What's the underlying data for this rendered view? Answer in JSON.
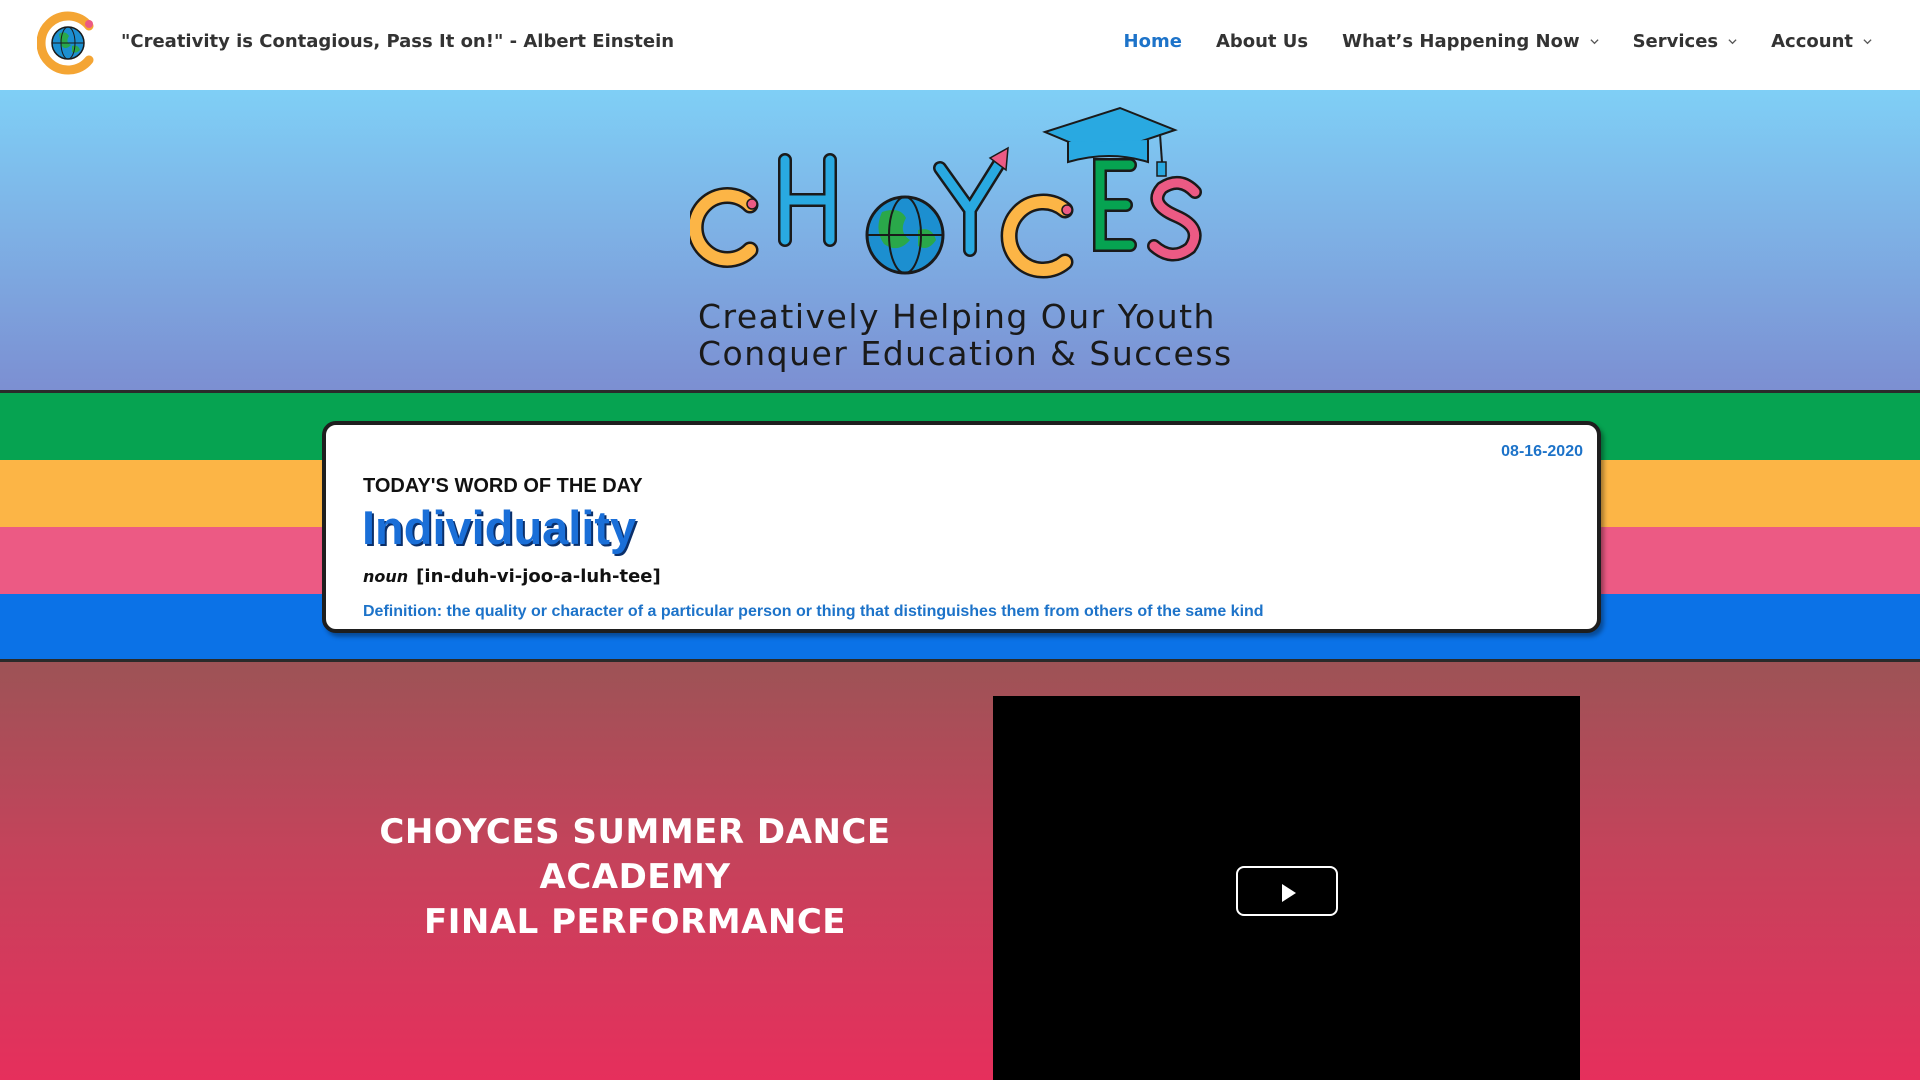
{
  "header": {
    "tagline": "\"Creativity is Contagious, Pass It on!\" - Albert Einstein",
    "nav": [
      {
        "label": "Home",
        "active": true,
        "dropdown": false
      },
      {
        "label": "About Us",
        "active": false,
        "dropdown": false
      },
      {
        "label": "What’s Happening Now",
        "active": false,
        "dropdown": true
      },
      {
        "label": "Services",
        "active": false,
        "dropdown": true
      },
      {
        "label": "Account",
        "active": false,
        "dropdown": true
      }
    ]
  },
  "hero": {
    "logo_text": "CHOYCES",
    "subtitle_line1": "Creatively Helping Our Youth",
    "subtitle_line2": "Conquer Education & Success"
  },
  "word_of_day": {
    "date": "08-16-2020",
    "label": "TODAY'S WORD OF THE DAY",
    "word": "Individuality",
    "part_of_speech": "noun",
    "pronunciation": "[in-duh-vi-joo-a-luh-tee]",
    "definition": "Definition: the quality or character of a particular person or thing that distinguishes them from others of the same kind"
  },
  "event": {
    "title_line1": "CHOYCES SUMMER DANCE",
    "title_line2": "ACADEMY",
    "title_line3": "FINAL PERFORMANCE"
  },
  "video": {
    "play_icon": "play-icon"
  },
  "colors": {
    "nav_active": "#1d73c9",
    "stripe_green": "#06a351",
    "stripe_yellow": "#fcb546",
    "stripe_pink": "#ec5a84",
    "stripe_blue": "#0b72e7"
  }
}
